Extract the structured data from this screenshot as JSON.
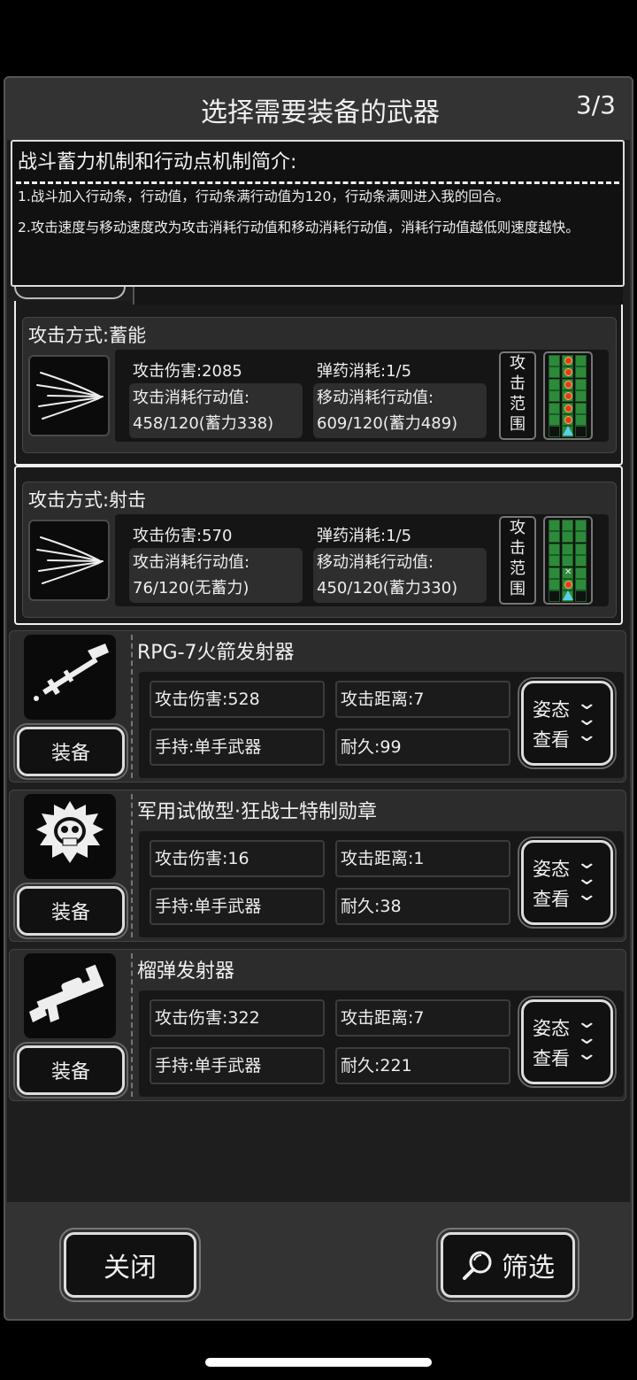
{
  "header": {
    "title": "选择需要装备的武器",
    "page": "3/3"
  },
  "info": {
    "title": "战斗蓄力机制和行动点机制简介:",
    "p1": "1.战斗加入行动条，行动值，行动条满行动值为120，行动条满则进入我的回合。",
    "p2": "2.攻击速度与移动速度改为攻击消耗行动值和移动消耗行动值，消耗行动值越低则速度越快。"
  },
  "modes": [
    {
      "title": "攻击方式:蓄能",
      "damage": "攻击伤害:2085",
      "ammo": "弹药消耗:1/5",
      "atk_label": "攻击消耗行动值:",
      "atk_val": "458/120(蓄力338)",
      "move_label": "移动消耗行动值:",
      "move_val": "609/120(蓄力489)",
      "range_label": "攻击范围"
    },
    {
      "title": "攻击方式:射击",
      "damage": "攻击伤害:570",
      "ammo": "弹药消耗:1/5",
      "atk_label": "攻击消耗行动值:",
      "atk_val": "76/120(无蓄力)",
      "move_label": "移动消耗行动值:",
      "move_val": "450/120(蓄力330)",
      "range_label": "攻击范围"
    }
  ],
  "weapons": [
    {
      "name": "RPG-7火箭发射器",
      "damage": "攻击伤害:528",
      "range": "攻击距离:7",
      "hold": "手持:单手武器",
      "durability": "耐久:99",
      "icon": "rpg-icon"
    },
    {
      "name": "军用试做型·狂战士特制勋章",
      "damage": "攻击伤害:16",
      "range": "攻击距离:1",
      "hold": "手持:单手武器",
      "durability": "耐久:38",
      "icon": "skull-medal-icon"
    },
    {
      "name": "榴弹发射器",
      "damage": "攻击伤害:322",
      "range": "攻击距离:7",
      "hold": "手持:单手武器",
      "durability": "耐久:221",
      "icon": "grenade-launcher-icon"
    }
  ],
  "labels": {
    "equip": "装备",
    "pose1": "姿态",
    "pose2": "查看",
    "close": "关闭",
    "filter": "筛选"
  },
  "colors": {
    "accent_green": "#2d8a3a",
    "dot_red": "#e23a2a",
    "player_marker": "#5ad0e8"
  }
}
